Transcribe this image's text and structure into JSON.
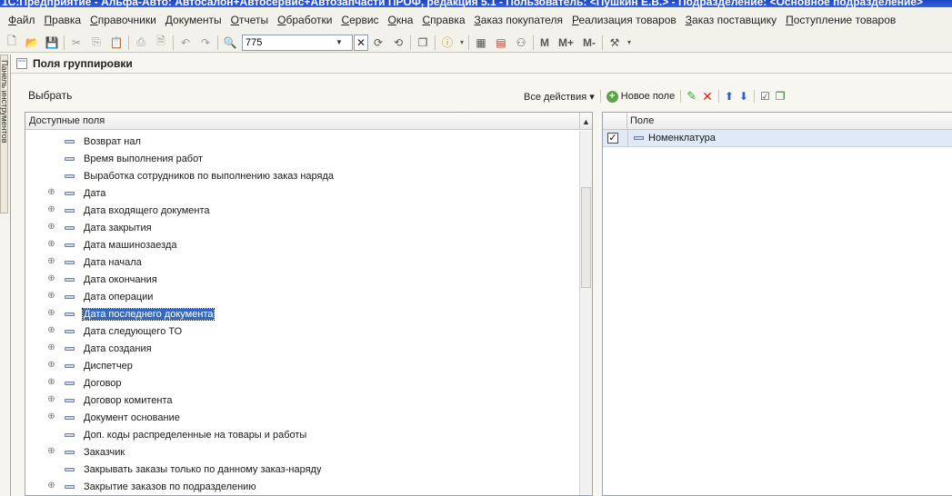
{
  "title": "1С:Предприятие - Альфа-Авто: Автосалон+Автосервис+Автозапчасти ПРОФ, редакция 5.1 - Пользователь: <Пушкин Е.В.> - Подразделение: <Основное подразделение>",
  "menu": [
    "Файл",
    "Правка",
    "Справочники",
    "Документы",
    "Отчеты",
    "Обработки",
    "Сервис",
    "Окна",
    "Справка",
    "Заказ покупателя",
    "Реализация товаров",
    "Заказ поставщику",
    "Поступление товаров"
  ],
  "toolbar": {
    "search_value": "775",
    "m": "M",
    "m_plus": "M+",
    "m_minus": "M-"
  },
  "left_tab_label": "Панель инструментов",
  "window": {
    "title": "Поля группировки"
  },
  "choose_label": "Выбрать",
  "actions": {
    "all_actions": "Все действия ▾",
    "new_field": "Новое поле"
  },
  "left_panel": {
    "header": "Доступные поля",
    "rows": [
      {
        "label": "Возврат нал",
        "expandable": false
      },
      {
        "label": "Время выполнения работ",
        "expandable": false
      },
      {
        "label": "Выработка сотрудников по выполнению заказ наряда",
        "expandable": false
      },
      {
        "label": "Дата",
        "expandable": true
      },
      {
        "label": "Дата входящего документа",
        "expandable": true
      },
      {
        "label": "Дата закрытия",
        "expandable": true
      },
      {
        "label": "Дата машинозаезда",
        "expandable": true
      },
      {
        "label": "Дата начала",
        "expandable": true
      },
      {
        "label": "Дата окончания",
        "expandable": true
      },
      {
        "label": "Дата операции",
        "expandable": true
      },
      {
        "label": "Дата последнего документа",
        "expandable": true,
        "selected": true
      },
      {
        "label": "Дата следующего ТО",
        "expandable": true
      },
      {
        "label": "Дата создания",
        "expandable": true
      },
      {
        "label": "Диспетчер",
        "expandable": true
      },
      {
        "label": "Договор",
        "expandable": true
      },
      {
        "label": "Договор комитента",
        "expandable": true
      },
      {
        "label": "Документ основание",
        "expandable": true
      },
      {
        "label": "Доп. коды распределенные на товары и работы",
        "expandable": false
      },
      {
        "label": "Заказчик",
        "expandable": true
      },
      {
        "label": "Закрывать заказы только по данному заказ-наряду",
        "expandable": false
      },
      {
        "label": "Закрытие заказов по подразделению",
        "expandable": true
      }
    ]
  },
  "right_panel": {
    "header": "Поле",
    "rows": [
      {
        "label": "Номенклатура",
        "checked": true
      }
    ]
  },
  "colors": {
    "accent": "#3369c4",
    "selected_row": "#dfe9f7",
    "title_bar": "#1c46c2"
  }
}
